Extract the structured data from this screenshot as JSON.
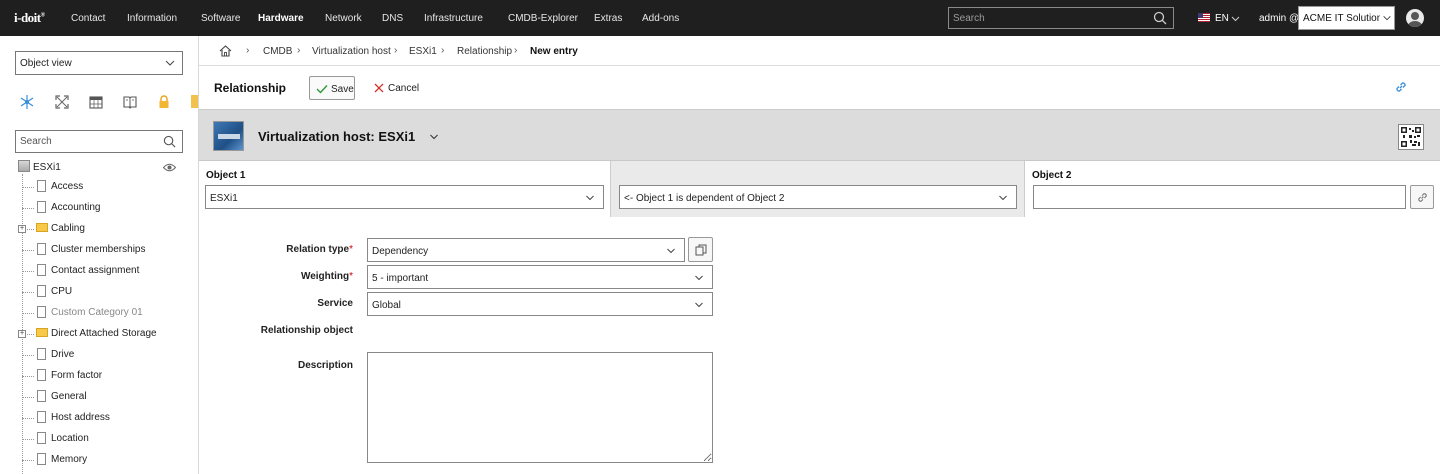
{
  "app": {
    "logo": "i-doit",
    "logo_mark": "®",
    "nav": [
      "Contact",
      "Information",
      "Software",
      "Hardware",
      "Network",
      "DNS",
      "Infrastructure",
      "CMDB-Explorer",
      "Extras",
      "Add-ons"
    ],
    "active_nav": "Hardware",
    "search_placeholder": "Search",
    "language": "EN",
    "user": "admin @",
    "tenant": "ACME IT Solutions"
  },
  "sidebar": {
    "view_select": "Object view",
    "search_placeholder": "Search",
    "tools": [
      "network-icon",
      "expand-icon",
      "calendar-icon",
      "book-icon",
      "lock-icon"
    ],
    "tree_root": "ESXi1",
    "tree_items": [
      {
        "label": "Access",
        "type": "doc"
      },
      {
        "label": "Accounting",
        "type": "doc"
      },
      {
        "label": "Cabling",
        "type": "folder"
      },
      {
        "label": "Cluster memberships",
        "type": "doc"
      },
      {
        "label": "Contact assignment",
        "type": "doc"
      },
      {
        "label": "CPU",
        "type": "doc"
      },
      {
        "label": "Custom Category 01",
        "type": "doc",
        "muted": true
      },
      {
        "label": "Direct Attached Storage",
        "type": "folder"
      },
      {
        "label": "Drive",
        "type": "doc"
      },
      {
        "label": "Form factor",
        "type": "doc"
      },
      {
        "label": "General",
        "type": "doc"
      },
      {
        "label": "Host address",
        "type": "doc"
      },
      {
        "label": "Location",
        "type": "doc"
      },
      {
        "label": "Memory",
        "type": "doc"
      }
    ]
  },
  "breadcrumb": [
    "CMDB",
    "Virtualization host",
    "ESXi1",
    "Relationship",
    "New entry"
  ],
  "toolbar": {
    "title": "Relationship",
    "save_label": "Save",
    "cancel_label": "Cancel"
  },
  "object": {
    "title": "Virtualization host: ESXi1"
  },
  "relation": {
    "object1_label": "Object 1",
    "object1_value": "ESXi1",
    "direction_value": "<- Object 1 is dependent of Object 2",
    "object2_label": "Object 2",
    "object2_value": ""
  },
  "form": {
    "relation_type_label": "Relation type",
    "relation_type_value": "Dependency",
    "weighting_label": "Weighting",
    "weighting_value": "5 - important",
    "service_label": "Service",
    "service_value": "Global",
    "relationship_object_label": "Relationship object",
    "description_label": "Description",
    "required_mark": "*"
  },
  "colors": {
    "topbar": "#1f1f1f",
    "header_band": "#dcdcdc",
    "required": "#cc0000",
    "save_check": "#2e9a3a",
    "cancel_x": "#d0312d",
    "toolbar_icon": "#3a8ed8",
    "lock_icon": "#e8a317"
  }
}
